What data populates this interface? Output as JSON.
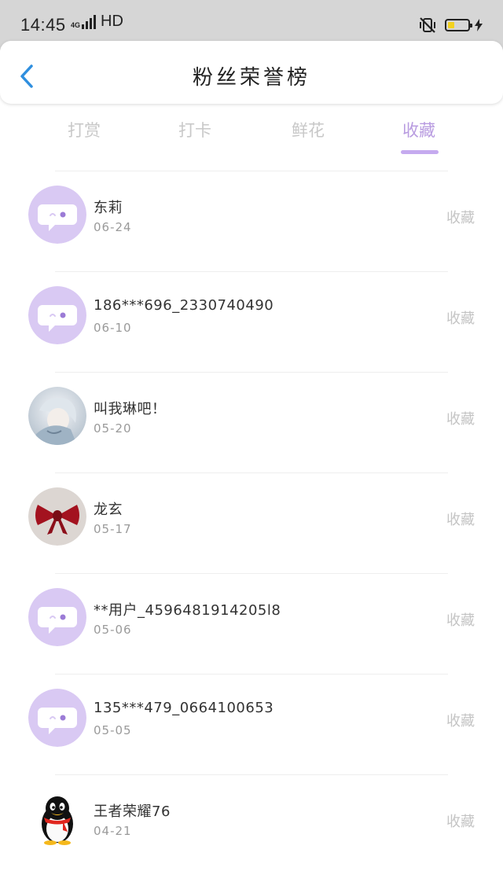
{
  "status_bar": {
    "time": "14:45",
    "network_small": "4G",
    "network_label": "HD",
    "battery_level": 0.35,
    "battery_color": "#f3d21f"
  },
  "header": {
    "back_icon": "chevron-left-icon",
    "title": "粉丝荣誉榜"
  },
  "tabs": [
    {
      "label": "打赏",
      "active": false
    },
    {
      "label": "打卡",
      "active": false
    },
    {
      "label": "鲜花",
      "active": false
    },
    {
      "label": "收藏",
      "active": true
    }
  ],
  "accent_color": "#b89be0",
  "list": [
    {
      "name": "东莉",
      "date": "06-24",
      "action": "收藏",
      "avatar": "default-chat-avatar"
    },
    {
      "name": "186***696_2330740490",
      "date": "06-10",
      "action": "收藏",
      "avatar": "default-chat-avatar"
    },
    {
      "name": "叫我琳吧！",
      "date": "05-20",
      "action": "收藏",
      "avatar": "anime-girl-photo"
    },
    {
      "name": "龙玄",
      "date": "05-17",
      "action": "收藏",
      "avatar": "red-bow-photo"
    },
    {
      "name": "**用户_4596481914205l8",
      "date": "05-06",
      "action": "收藏",
      "avatar": "default-chat-avatar"
    },
    {
      "name": "135***479_0664100653",
      "date": "05-05",
      "action": "收藏",
      "avatar": "default-chat-avatar"
    },
    {
      "name": "王者荣耀76",
      "date": "04-21",
      "action": "收藏",
      "avatar": "qq-penguin"
    }
  ]
}
